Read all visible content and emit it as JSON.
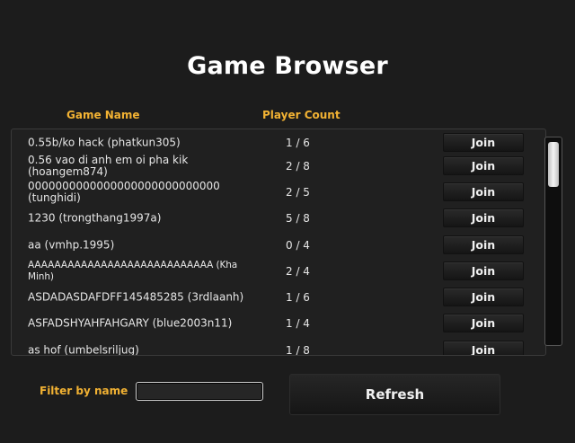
{
  "title": "Game Browser",
  "columns": {
    "name": "Game Name",
    "count": "Player Count"
  },
  "rows": [
    {
      "name": "0.55b/ko hack (phatkun305)",
      "count": "1 / 6",
      "join": "Join"
    },
    {
      "name": "0.56 vao di anh em oi pha kik (hoangem874)",
      "count": "2 / 8",
      "join": "Join"
    },
    {
      "name": "0000000000000000000000000000 (tunghidi)",
      "count": "2 / 5",
      "join": "Join"
    },
    {
      "name": "1230 (trongthang1997a)",
      "count": "5 / 8",
      "join": "Join"
    },
    {
      "name": "aa (vmhp.1995)",
      "count": "0 / 4",
      "join": "Join"
    },
    {
      "name": "AAAAAAAAAAAAAAAAAAAAAAAAAAAA (Kha Minh)",
      "count": "2 / 4",
      "join": "Join"
    },
    {
      "name": "ASDADASDAFDFF145485285 (3rdlaanh)",
      "count": "1 / 6",
      "join": "Join"
    },
    {
      "name": "ASFADSHYAHFAHGARY (blue2003n11)",
      "count": "1 / 4",
      "join": "Join"
    },
    {
      "name": "as hof (umbelsriljug)",
      "count": "1 / 8",
      "join": "Join"
    }
  ],
  "filter": {
    "label": "Filter by name",
    "value": ""
  },
  "refresh": "Refresh",
  "colors": {
    "accent": "#f2b233",
    "background": "#1c1c1c"
  }
}
